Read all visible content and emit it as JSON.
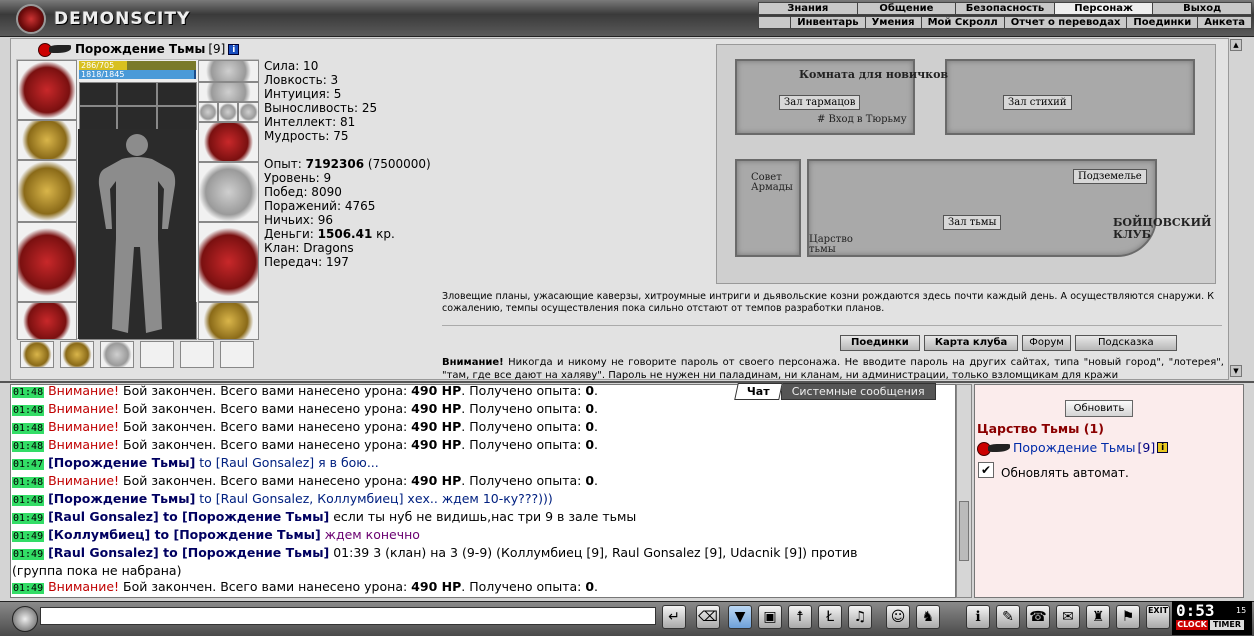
{
  "header": {
    "logo_text": "DEMONSCITY",
    "menu_top": [
      "Знания",
      "Общение",
      "Безопасность",
      "Персонаж",
      "Выход"
    ],
    "menu_active": "Персонаж",
    "menu_sub": [
      "Инвентарь",
      "Умения",
      "Мой Скролл",
      "Отчет о переводах",
      "Поединки",
      "Анкета"
    ]
  },
  "character": {
    "name": "Порождение Тьмы",
    "level": "[9]",
    "hp_text": "286/705",
    "hp_fraction": 0.41,
    "mp_text": "1818/1845",
    "mp_fraction": 0.985
  },
  "stats": {
    "attrs": [
      "Сила: 10",
      "Ловкость: 3",
      "Интуиция: 5",
      "Выносливость: 25",
      "Интеллект: 81",
      "Мудрость: 75"
    ],
    "exp_label": "Опыт: ",
    "exp_value": "7192306",
    "exp_next": " (7500000)",
    "level": "Уровень: 9",
    "wins": "Побед: 8090",
    "losses": "Поражений: 4765",
    "draws": "Ничьих: 96",
    "money_label": "Деньги: ",
    "money_value": "1506.41",
    "money_unit": " кр.",
    "clan": "Клан: Dragons",
    "transfers": "Передач: 197"
  },
  "map": {
    "rooms": {
      "tarmans": "Зал тармацов",
      "elements": "Зал стихий",
      "underground": "Подземелье",
      "darkness": "Зал тьмы"
    },
    "newbie_room": "Комната для новичков",
    "prison_entry": "# Вход в Тюрьму",
    "council": "Совет Армады",
    "kingdom": "Царство тьмы",
    "club": "БОЙЦОВСКИЙ КЛУБ"
  },
  "description": "Зловещие планы, ужасающие каверзы, хитроумные интриги и дьявольские козни рождаются здесь почти каждый день. А осуществляются снаружи. К сожалению, темпы осуществления пока сильно отстают от темпов разработки планов.",
  "buttons": {
    "duels": "Поединки",
    "club_map": "Карта клуба",
    "forum": "Форум",
    "hint": "Подсказка"
  },
  "warning": {
    "bold": "Внимание!",
    "text": " Никогда и никому не говорите пароль от своего персонажа. Не вводите пароль на других сайтах, типа \"новый город\", \"лотерея\", \"там, где все дают на халяву\". Пароль не нужен ни паладинам, ни кланам, ни администрации, только взломщикам для кражи"
  },
  "chat_tabs": {
    "chat": "Чат",
    "system": "Системные сообщения"
  },
  "chat": [
    {
      "time": "01:48",
      "type": "sys",
      "warn": "Внимание!",
      "text": " Бой закончен. Всего вами нанесено урона: ",
      "dmg": "490 HP",
      "text2": ". Получено опыта: ",
      "exp": "0",
      "end": "."
    },
    {
      "time": "01:48",
      "type": "sys",
      "warn": "Внимание!",
      "text": " Бой закончен. Всего вами нанесено урона: ",
      "dmg": "490 HP",
      "text2": ". Получено опыта: ",
      "exp": "0",
      "end": "."
    },
    {
      "time": "01:48",
      "type": "sys",
      "warn": "Внимание!",
      "text": " Бой закончен. Всего вами нанесено урона: ",
      "dmg": "490 HP",
      "text2": ". Получено опыта: ",
      "exp": "0",
      "end": "."
    },
    {
      "time": "01:48",
      "type": "sys",
      "warn": "Внимание!",
      "text": " Бой закончен. Всего вами нанесено урона: ",
      "dmg": "490 HP",
      "text2": ". Получено опыта: ",
      "exp": "0",
      "end": "."
    },
    {
      "time": "01:48",
      "type": "sys",
      "warn": "Внимание!",
      "text": " Бой закончен. Всего вами нанесено урона: ",
      "dmg": "490 HP",
      "text2": ". Получено опыта: ",
      "exp": "0",
      "end": "."
    },
    {
      "time": "01:47",
      "type": "msg",
      "nick": "[Порождение Тьмы]",
      "to": " to [Raul Gonsalez] я в бою..."
    },
    {
      "time": "01:48",
      "type": "sys",
      "warn": "Внимание!",
      "text": " Бой закончен. Всего вами нанесено урона: ",
      "dmg": "490 HP",
      "text2": ". Получено опыта: ",
      "exp": "0",
      "end": "."
    },
    {
      "time": "01:48",
      "type": "msg",
      "nick": "[Порождение Тьмы]",
      "to": " to [Raul Gonsalez, Коллумбиец] хех.. ждем 10-ку???)))"
    },
    {
      "time": "01:49",
      "type": "msg2",
      "nick": "[Raul Gonsalez]",
      "to": " to [Порождение Тьмы]",
      "text": " если ты нуб не видишь,нас три 9 в зале тьмы"
    },
    {
      "time": "01:49",
      "type": "msg3",
      "nick": "[Коллумбиец]",
      "to": " to [Порождение Тьмы]",
      "text": " ждем конечно"
    },
    {
      "time": "01:49",
      "type": "msg2",
      "nick": "[Raul Gonsalez]",
      "to": " to [Порождение Тьмы]",
      "text": " 01:39 3 (клан) на 3 (9-9) (Коллумбиец [9], Raul Gonsalez [9], Udacnik [9]) против"
    },
    {
      "time": "",
      "type": "plain",
      "text": "(группа пока не набрана)"
    },
    {
      "time": "01:49",
      "type": "sys",
      "warn": "Внимание!",
      "text": " Бой закончен. Всего вами нанесено урона: ",
      "dmg": "490 HP",
      "text2": ". Получено опыта: ",
      "exp": "0",
      "end": "."
    }
  ],
  "right_panel": {
    "refresh": "Обновить",
    "room": "Царство Тьмы (1)",
    "user": "Порождение Тьмы",
    "user_level": "[9]",
    "auto_label": "Обновлять автомат.",
    "auto_checked": "✔"
  },
  "clock": {
    "time": "0:53",
    "sec": "15",
    "clock_label": "CLOCK",
    "timer_label": "TIMER"
  },
  "colors": {
    "time_bg": "#33dd66",
    "warn": "#c00000",
    "room": "#8a0000"
  }
}
